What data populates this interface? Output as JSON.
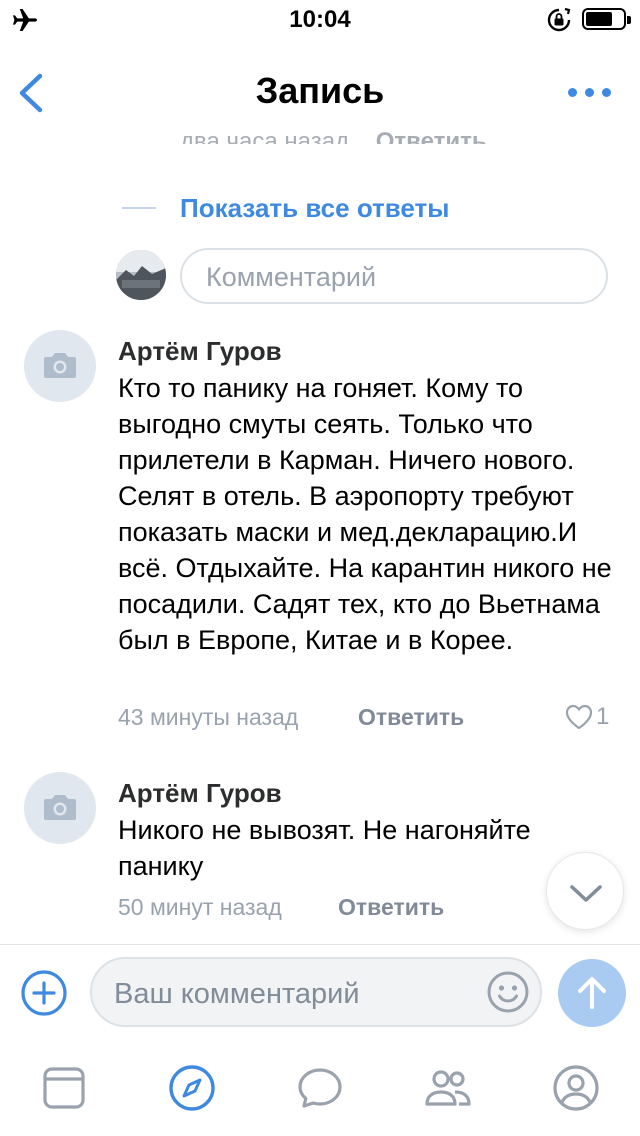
{
  "status_bar": {
    "time": "10:04"
  },
  "nav": {
    "title": "Запись",
    "back_icon": "chevron-left-icon",
    "more_icon": "more-horizontal-icon"
  },
  "thread": {
    "partial_meta": "два часа назад",
    "partial_reply": "Ответить",
    "show_all_replies": "Показать все ответы",
    "reply_placeholder": "Комментарий"
  },
  "comments": [
    {
      "author": "Артём Гуров",
      "text": "Кто то панику на гоняет. Кому то выгодно смуты сеять. Только что прилетели в Карман. Ничего нового. Селят в отель. В аэропорту требуют показать маски и мед.декларацию.И всё. Отдыхайте. На карантин никого не посадили. Садят тех, кто до Вьетнама был в Европе, Китае и в Корее.",
      "time": "43 минуты назад",
      "reply_label": "Ответить",
      "likes": "1"
    },
    {
      "author": "Артём Гуров",
      "text": "Никого не вывозят. Не нагоняйте панику",
      "time": "50 минут назад",
      "reply_label": "Ответить"
    }
  ],
  "composer": {
    "placeholder": "Ваш комментарий",
    "attach_icon": "plus-circle-icon",
    "emoji_icon": "smile-icon",
    "send_icon": "arrow-up-icon"
  },
  "tab_bar": {
    "items": [
      "news-tab-icon",
      "discover-tab-icon",
      "messages-tab-icon",
      "friends-tab-icon",
      "profile-tab-icon"
    ]
  },
  "colors": {
    "accent": "#3f8ae0",
    "secondary_text": "#99a2ad",
    "send_disabled": "#a9cbf2"
  }
}
